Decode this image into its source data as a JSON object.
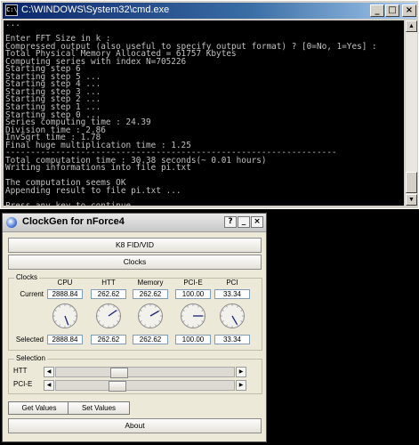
{
  "cmd": {
    "title": "C:\\WINDOWS\\System32\\cmd.exe",
    "icon": "console-icon",
    "lines": [
      "...",
      "",
      "Enter FFT Size in k :",
      "Compressed output (also useful to specify output format) ? [0=No, 1=Yes] :",
      "Total Physical Memory Allocated = 61757 Kbytes",
      "Computing series with index N=705226",
      "Starting step 6",
      "Starting step 5 ...",
      "Starting step 4 ...",
      "Starting step 3 ...",
      "Starting step 2 ...",
      "Starting step 1 ...",
      "Starting step 0 ...",
      "Series computing time : 24.39",
      "Division time : 2.86",
      "InvSqrt time : 1.78",
      "Final huge multiplication time : 1.25",
      "------------------------------------------------------------------",
      "Total computation time : 30.38 seconds(~ 0.01 hours)",
      "Writing informations into file pi.txt",
      "",
      "The computation seems OK",
      "Appending result to file pi.txt ...",
      "",
      "Press any key to continue . . ."
    ],
    "buttons": {
      "minimize": "_",
      "maximize": "□",
      "close": "×"
    }
  },
  "clockgen": {
    "title": "ClockGen for nForce4",
    "buttons": {
      "help": "?",
      "minimize": "_",
      "close": "×"
    },
    "k8_button": "K8 FID/VID",
    "clocks_button": "Clocks",
    "clocks_group": "Clocks",
    "row_current": "Current",
    "row_selected": "Selected",
    "columns": [
      "CPU",
      "HTT",
      "Memory",
      "PCI-E",
      "PCI"
    ],
    "current": [
      "2888.84",
      "262.62",
      "262.62",
      "100.00",
      "33.34"
    ],
    "selected": [
      "2888.84",
      "262.62",
      "262.62",
      "100.00",
      "33.34"
    ],
    "dial_angles_deg": [
      160,
      55,
      60,
      90,
      150
    ],
    "selection_group": "Selection",
    "sliders": [
      {
        "label": "HTT",
        "position": 0.34
      },
      {
        "label": "PCI-E",
        "position": 0.33
      }
    ],
    "get_values": "Get Values",
    "set_values": "Set Values",
    "about": "About"
  }
}
